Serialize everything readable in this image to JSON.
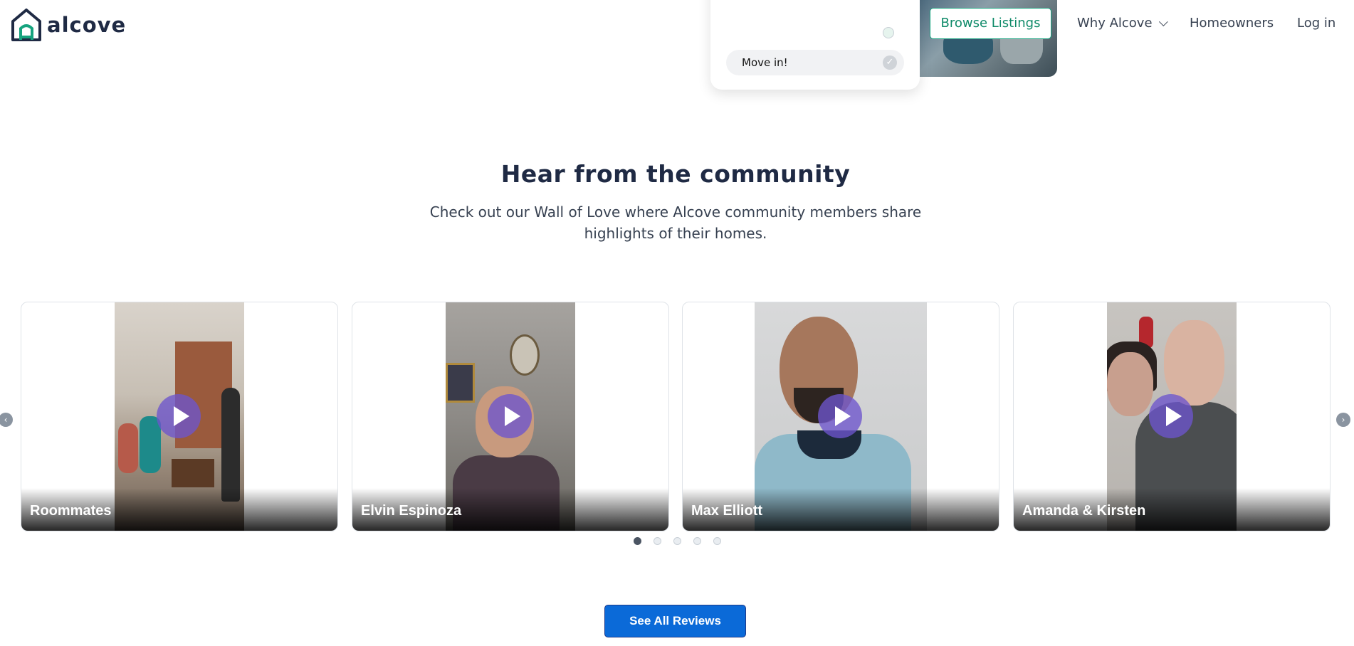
{
  "header": {
    "logo_text": "alcove",
    "browse_label": "Browse Listings",
    "nav": {
      "why": "Why Alcove",
      "homeowners": "Homeowners",
      "login": "Log in"
    }
  },
  "hero_fragments": {
    "steps_card": {
      "faded_steps": [
        "",
        ""
      ],
      "move_in_label": "Move in!"
    }
  },
  "community": {
    "title": "Hear from the community",
    "subtitle": "Check out our Wall of Love where Alcove community members share highlights of their homes.",
    "videos": [
      {
        "name": "Roommates"
      },
      {
        "name": "Elvin Espinoza"
      },
      {
        "name": "Max Elliott"
      },
      {
        "name": "Amanda & Kirsten"
      }
    ],
    "pagination": {
      "total": 5,
      "active": 1
    },
    "see_all_label": "See All Reviews"
  },
  "colors": {
    "brand_green": "#16a37e",
    "primary_blue": "#0b6ad8",
    "play_purple": "#6d55cd",
    "heading": "#1f2a44"
  },
  "icons": [
    "logo-house-icon",
    "chevron-down-icon",
    "check-icon",
    "chevron-left-icon",
    "chevron-right-icon",
    "play-icon"
  ]
}
